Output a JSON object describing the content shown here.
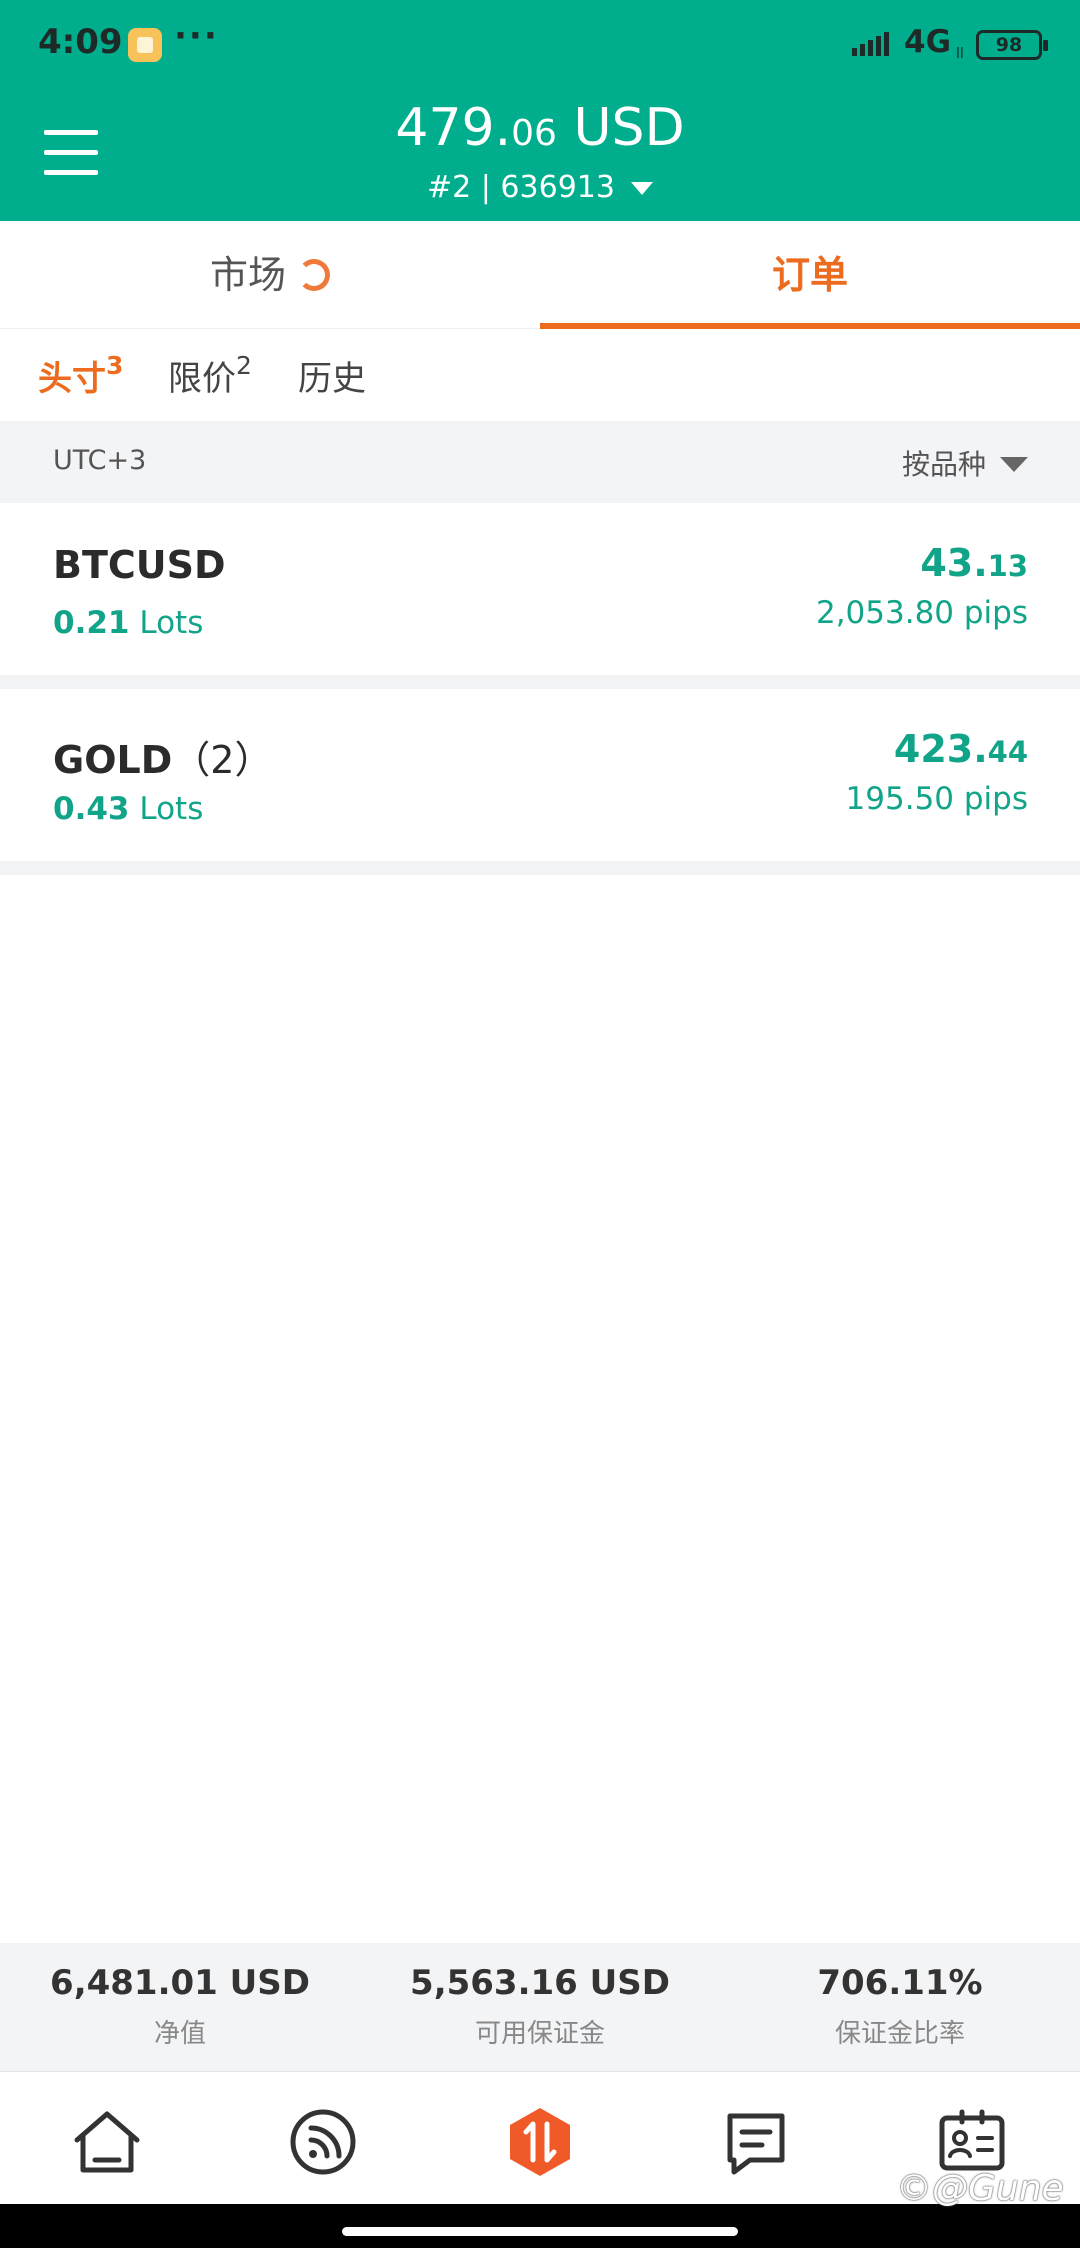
{
  "status_bar": {
    "time": "4:09",
    "more": "···",
    "network": "4G",
    "network_sub": "ll",
    "battery": "98"
  },
  "header": {
    "balance_main": "479.",
    "balance_decimal": "06",
    "balance_currency": " USD",
    "account": "#2 | 636913"
  },
  "tabs": {
    "market": "市场",
    "orders": "订单"
  },
  "sub_tabs": [
    {
      "label": "头寸",
      "badge": "3"
    },
    {
      "label": "限价",
      "badge": "2"
    },
    {
      "label": "历史",
      "badge": ""
    }
  ],
  "filter": {
    "timezone": "UTC+3",
    "group_by": "按品种"
  },
  "positions": [
    {
      "symbol": "BTCUSD",
      "count": "",
      "lots_value": "0.21",
      "lots_unit": " Lots",
      "profit_int": "43.",
      "profit_dec": "13",
      "pips": "2,053.80 pips"
    },
    {
      "symbol": "GOLD",
      "count": "（2）",
      "lots_value": "0.43",
      "lots_unit": " Lots",
      "profit_int": "423.",
      "profit_dec": "44",
      "pips": "195.50 pips"
    }
  ],
  "summary": [
    {
      "value": "6,481.01 USD",
      "label": "净值"
    },
    {
      "value": "5,563.16 USD",
      "label": "可用保证金"
    },
    {
      "value": "706.11%",
      "label": "保证金比率"
    }
  ],
  "watermark": "©@Gune",
  "colors": {
    "header": "#00ad8d",
    "accent": "#ec6b1f",
    "profit": "#12a488"
  },
  "icons": {
    "nav": [
      "home-icon",
      "signal-feed-icon",
      "trade-icon",
      "messages-icon",
      "profile-card-icon"
    ]
  }
}
